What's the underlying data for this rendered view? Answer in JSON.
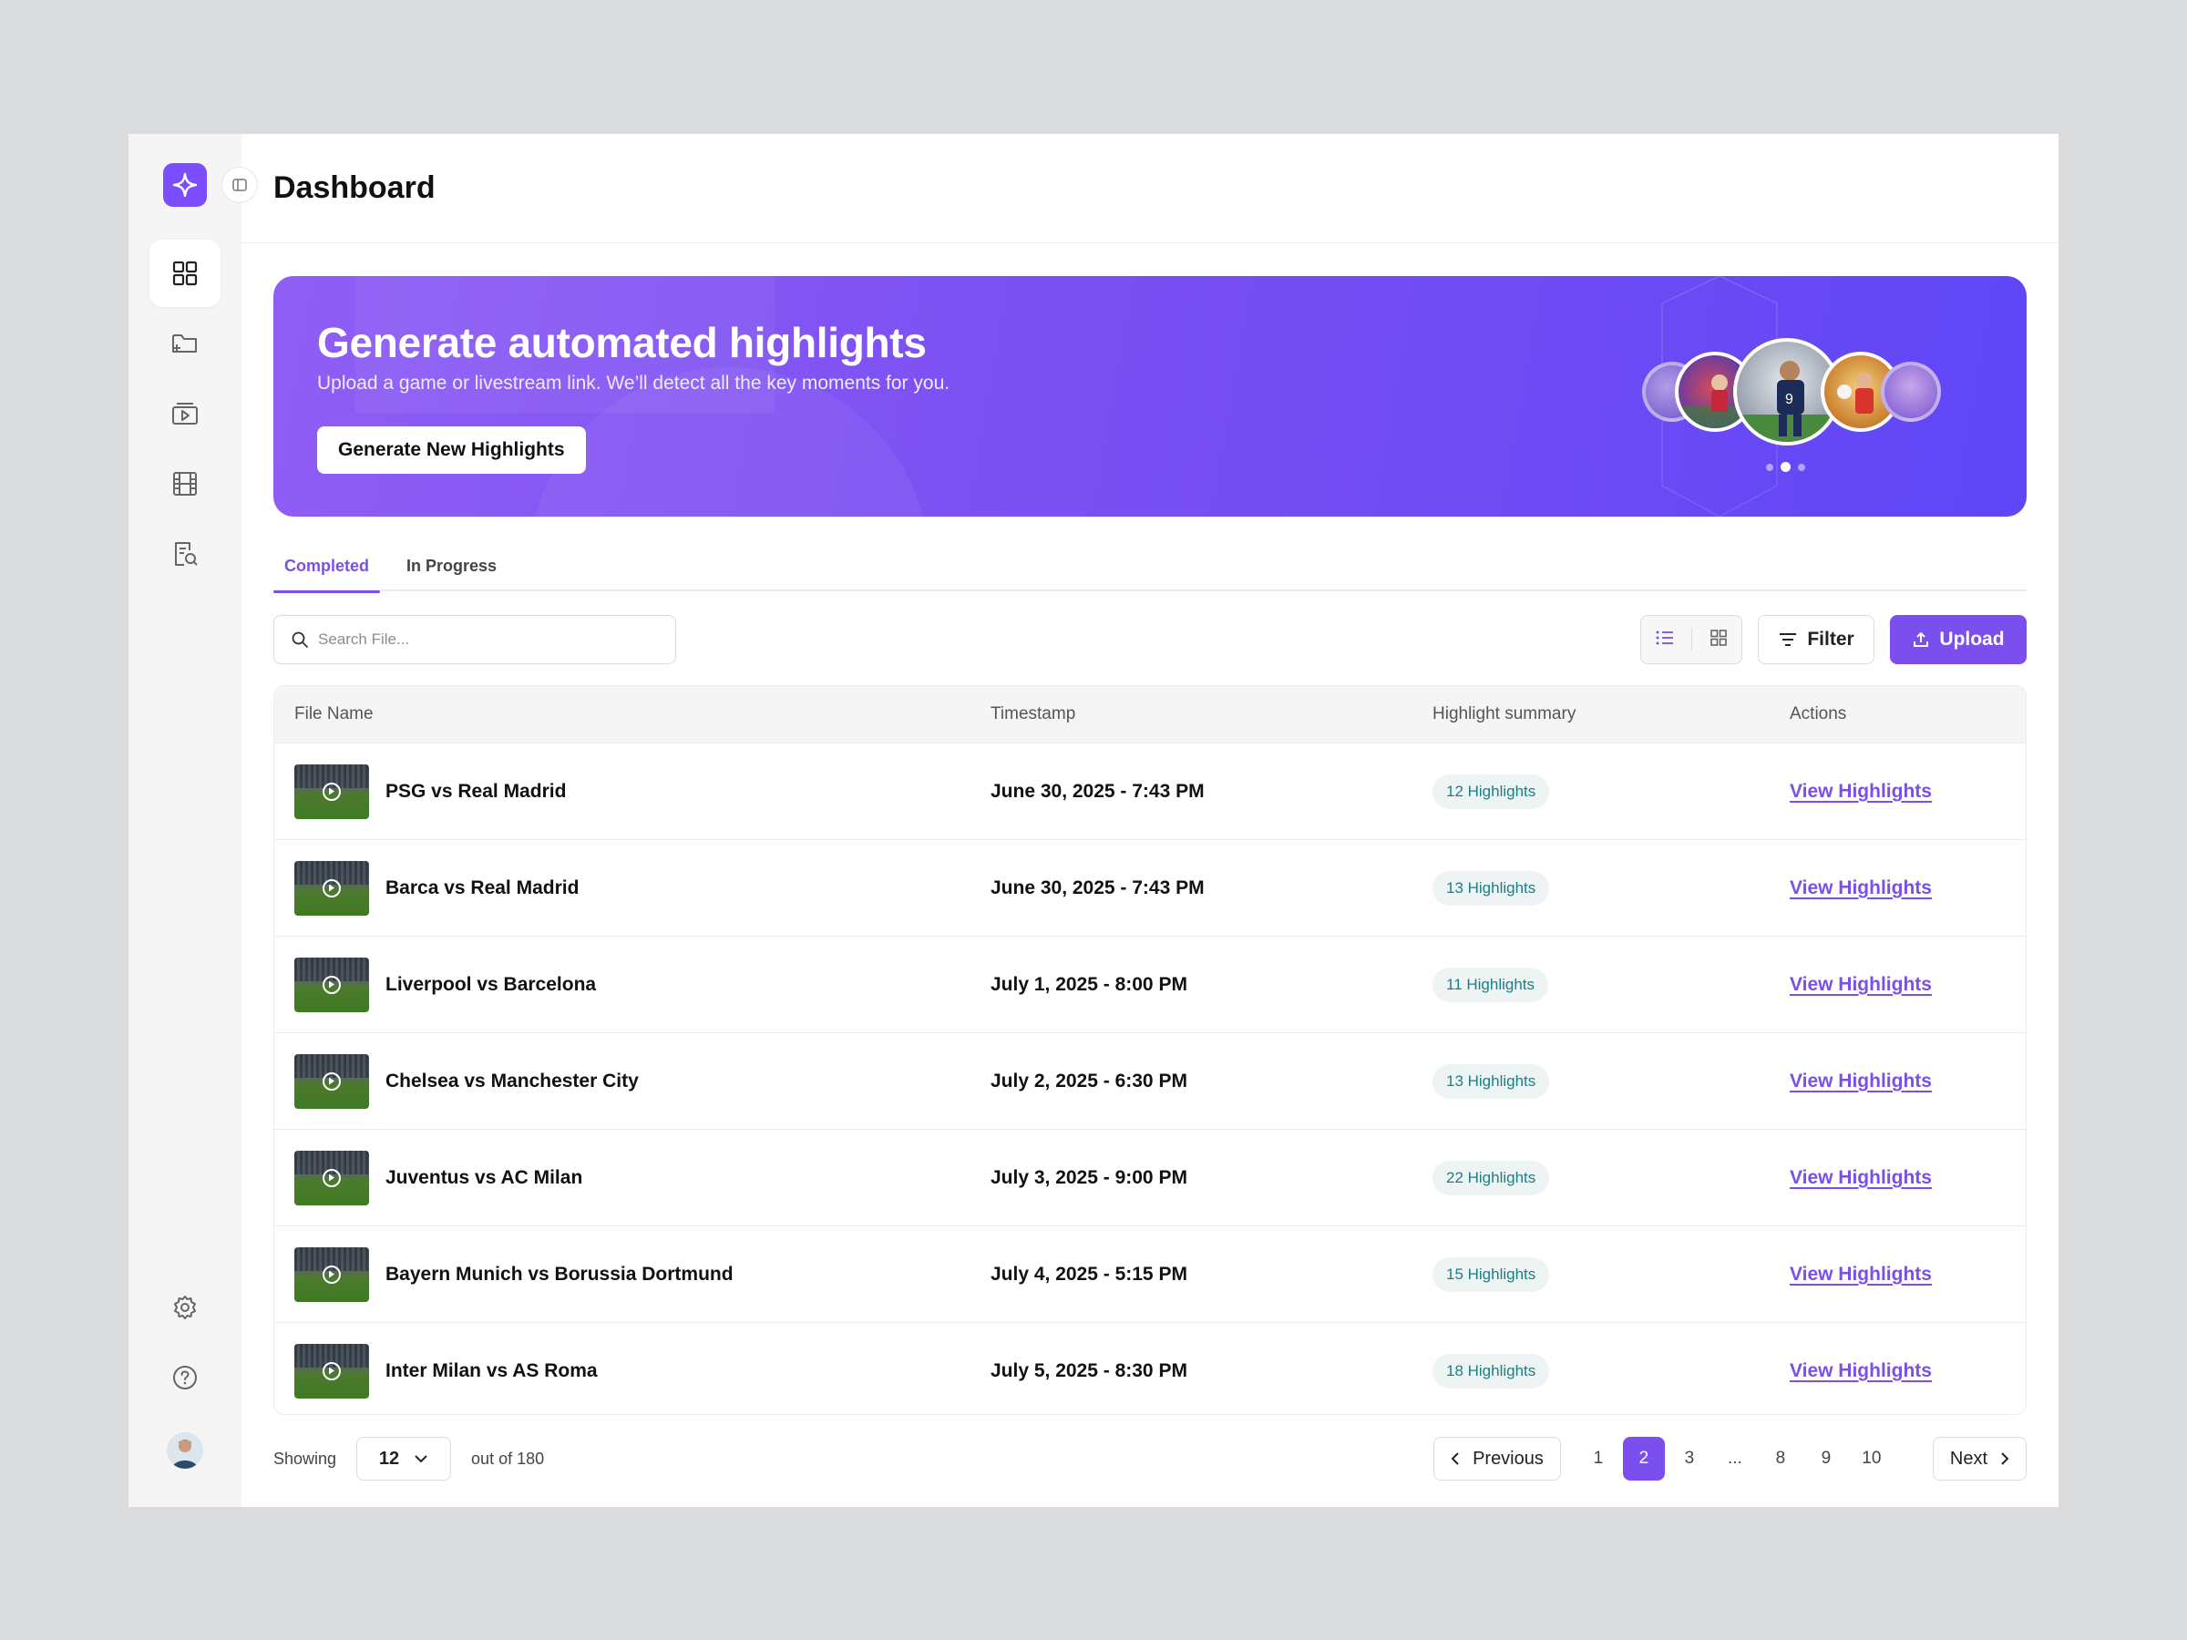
{
  "header": {
    "title": "Dashboard"
  },
  "sidebar": {
    "items": [
      {
        "icon": "dashboard-grid-icon",
        "active": true
      },
      {
        "icon": "folder-add-icon",
        "active": false
      },
      {
        "icon": "media-library-icon",
        "active": false
      },
      {
        "icon": "film-icon",
        "active": false
      },
      {
        "icon": "document-search-icon",
        "active": false
      }
    ],
    "bottom": [
      {
        "icon": "gear-icon"
      },
      {
        "icon": "help-icon"
      },
      {
        "icon": "avatar"
      }
    ]
  },
  "banner": {
    "title": "Generate automated highlights",
    "subtitle": "Upload a game or livestream link. We’ll detect all the key moments for you.",
    "button_label": "Generate New Highlights",
    "carousel_active_index": 1,
    "carousel_count": 3
  },
  "tabs": [
    {
      "label": "Completed",
      "active": true
    },
    {
      "label": "In Progress",
      "active": false
    }
  ],
  "toolbar": {
    "search_placeholder": "Search File...",
    "filter_label": "Filter",
    "upload_label": "Upload"
  },
  "table": {
    "columns": [
      "File Name",
      "Timestamp",
      "Highlight summary",
      "Actions"
    ],
    "rows": [
      {
        "name": "PSG vs Real Madrid",
        "timestamp": "June 30, 2025 - 7:43 PM",
        "summary": "12 Highlights",
        "action": "View Highlights"
      },
      {
        "name": "Barca vs Real Madrid",
        "timestamp": "June 30, 2025 - 7:43 PM",
        "summary": "13 Highlights",
        "action": "View Highlights"
      },
      {
        "name": "Liverpool vs Barcelona",
        "timestamp": "July 1, 2025 - 8:00 PM",
        "summary": "11 Highlights",
        "action": "View Highlights"
      },
      {
        "name": "Chelsea vs Manchester City",
        "timestamp": "July 2, 2025 - 6:30 PM",
        "summary": "13 Highlights",
        "action": "View Highlights"
      },
      {
        "name": "Juventus vs AC Milan",
        "timestamp": "July 3, 2025 - 9:00 PM",
        "summary": "22 Highlights",
        "action": "View Highlights"
      },
      {
        "name": "Bayern Munich vs Borussia Dortmund",
        "timestamp": "July 4, 2025 - 5:15 PM",
        "summary": "15 Highlights",
        "action": "View Highlights"
      },
      {
        "name": "Inter Milan vs AS Roma",
        "timestamp": "July 5, 2025 - 8:30 PM",
        "summary": "18 Highlights",
        "action": "View Highlights"
      }
    ]
  },
  "pagination": {
    "showing_label": "Showing",
    "page_size": "12",
    "total_label": "out of 180",
    "prev_label": "Previous",
    "next_label": "Next",
    "pages": [
      "1",
      "2",
      "3",
      "...",
      "8",
      "9",
      "10"
    ],
    "current_page": "2"
  },
  "colors": {
    "accent": "#7b4fee",
    "badge_text": "#1b7f86",
    "badge_bg": "#eef3f3"
  }
}
